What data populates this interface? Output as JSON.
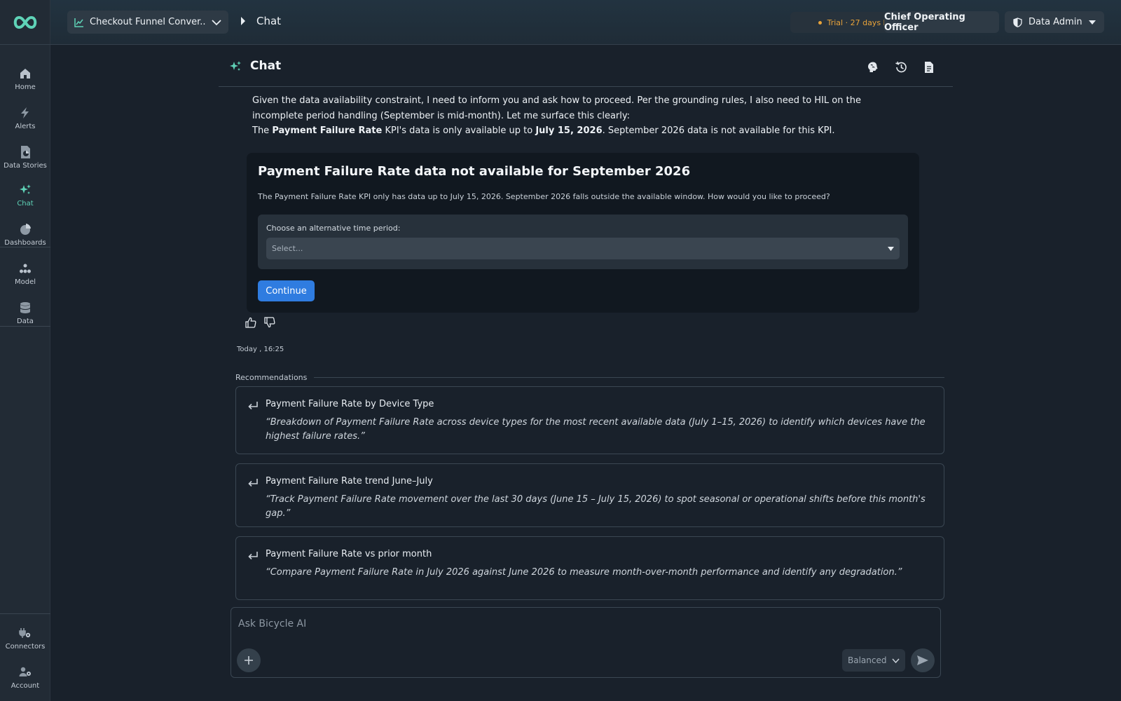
{
  "sidebar": {
    "items": [
      {
        "label": "Home",
        "icon": "home-icon"
      },
      {
        "label": "Alerts",
        "icon": "bolt-icon"
      },
      {
        "label": "Data Stories",
        "icon": "stories-icon"
      },
      {
        "label": "Chat",
        "icon": "sparkles-icon"
      },
      {
        "label": "Dashboards",
        "icon": "pie-icon"
      },
      {
        "label": "Model",
        "icon": "model-icon"
      },
      {
        "label": "Data",
        "icon": "database-icon"
      }
    ],
    "bottom_items": [
      {
        "label": "Connectors",
        "icon": "plug-icon"
      },
      {
        "label": "Account",
        "icon": "user-gear-icon"
      }
    ],
    "active_item": "Chat"
  },
  "topbar": {
    "dashboard_select": "Checkout Funnel Conver...",
    "current": "Chat",
    "trial": "Trial · 27 days left",
    "role": "Chief Operating Officer",
    "admin": "Data Admin"
  },
  "chat": {
    "title": "Chat",
    "intro_line": "Given the data availability constraint, I need to inform you and ask how to proceed. Per the grounding rules, I also need to HIL on the incomplete period handling (September is mid-month). Let me surface this clearly:",
    "kpi_prefix": "The ",
    "kpi_name": "Payment Failure Rate",
    "kpi_mid": " KPI's data is only available up to ",
    "kpi_date": "July 15, 2026",
    "kpi_suffix": ". September 2026 data is not available for this KPI.",
    "card": {
      "title": "Payment Failure Rate data not available for September 2026",
      "description": "The Payment Failure Rate KPI only has data up to July 15, 2026. September 2026 falls outside the available window. How would you like to proceed?",
      "select_label": "Choose an alternative time period:",
      "select_placeholder": "Select...",
      "continue_label": "Continue"
    },
    "timestamp": "Today , 16:25"
  },
  "recommendations": {
    "label": "Recommendations",
    "items": [
      {
        "title": "Payment Failure Rate by Device Type",
        "quote": "“Breakdown of Payment Failure Rate across device types for the most recent available data (July 1–15, 2026) to identify which devices have the highest failure rates.”"
      },
      {
        "title": "Payment Failure Rate trend June–July",
        "quote": "“Track Payment Failure Rate movement over the last 30 days (June 15 – July 15, 2026) to spot seasonal or operational shifts before this month's gap.”"
      },
      {
        "title": "Payment Failure Rate vs prior month",
        "quote": "“Compare Payment Failure Rate in July 2026 against June 2026 to measure month-over-month performance and identify any degradation.”"
      }
    ]
  },
  "composer": {
    "placeholder": "Ask Bicycle AI",
    "mode": "Balanced"
  },
  "colors": {
    "accent": "#5fd3b7",
    "primary_button": "#2f7ce0",
    "trial": "#e8a33a",
    "background": "#19212b"
  }
}
